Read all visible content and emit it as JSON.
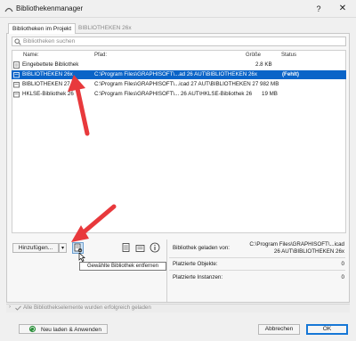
{
  "window": {
    "title": "Bibliothekenmanager",
    "help": "?",
    "close": "✕"
  },
  "tabs": [
    {
      "label": "Bibliotheken im Projekt",
      "active": true
    },
    {
      "label": "BIBLIOTHEKEN 26x",
      "active": false
    }
  ],
  "search": {
    "placeholder": "Bibliotheken suchen"
  },
  "list": {
    "columns": [
      "Name:",
      "Pfad:",
      "Größe",
      "Status"
    ],
    "rows": [
      {
        "name": "Eingebettete Bibliothek",
        "path": "",
        "size": "2.8 KB",
        "status": "",
        "selected": false
      },
      {
        "name": "BIBLIOTHEKEN 26x",
        "path": "C:\\Program Files\\GRAPHISOFT\\...ad 26 AUT\\BIBLIOTHEKEN 26x",
        "size": "",
        "status": "(Fehlt)",
        "selected": true
      },
      {
        "name": "BIBLIOTHEKEN 27",
        "path": "C:\\Program Files\\GRAPHISOFT\\...icad 27 AUT\\BIBLIOTHEKEN 27",
        "size": "982 MB",
        "status": "",
        "selected": false
      },
      {
        "name": "HKLSE-Bibliothek 26",
        "path": "C:\\Program Files\\GRAPHISOFT\\... 26 AUT\\HKLSE-Bibliothek 26",
        "size": "19 MB",
        "status": "",
        "selected": false
      }
    ]
  },
  "toolbar": {
    "add_label": "Hinzufügen...",
    "add_arrow": "▾",
    "tooltip": "Gewählte Bibliothek entfernen"
  },
  "info": {
    "loaded_from_label": "Bibliothek geladen von:",
    "loaded_from_line1": "C:\\Program Files\\GRAPHISOFT\\...icad",
    "loaded_from_line2": "26 AUT\\BIBLIOTHEKEN 26x",
    "objects_label": "Platzierte Objekte:",
    "objects_value": "0",
    "instances_label": "Platzierte Instanzen:",
    "instances_value": "0"
  },
  "status": {
    "text": "Alle Bibliothekselemente wurden erfolgreich geladen"
  },
  "footer": {
    "reload_label": "Neu laden & Anwenden",
    "cancel_label": "Abbrechen",
    "ok_label": "OK"
  },
  "colors": {
    "accent": "#0a64c8",
    "arrow": "#e8393c"
  }
}
